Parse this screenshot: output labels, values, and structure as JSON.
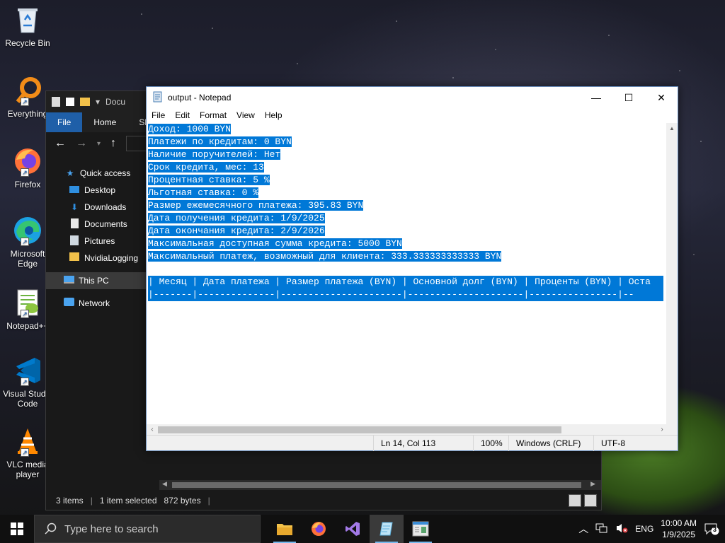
{
  "desktop": {
    "icons": [
      {
        "label": "Recycle Bin",
        "icon": "recycle-bin-icon"
      },
      {
        "label": "Everything",
        "icon": "everything-search-icon"
      },
      {
        "label": "Firefox",
        "icon": "firefox-icon"
      },
      {
        "label": "Microsoft Edge",
        "icon": "edge-icon"
      },
      {
        "label": "Notepad++",
        "icon": "notepadpp-icon"
      },
      {
        "label": "Visual Studio Code",
        "icon": "vscode-icon"
      },
      {
        "label": "VLC media player",
        "icon": "vlc-icon"
      }
    ]
  },
  "explorer": {
    "title_partial": "Docu",
    "ribbon_tabs": [
      "File",
      "Home",
      "Sh"
    ],
    "sidebar": [
      {
        "label": "Quick access",
        "icon": "star-icon"
      },
      {
        "label": "Desktop",
        "icon": "desktop-folder-icon"
      },
      {
        "label": "Downloads",
        "icon": "downloads-icon"
      },
      {
        "label": "Documents",
        "icon": "documents-icon"
      },
      {
        "label": "Pictures",
        "icon": "pictures-icon"
      },
      {
        "label": "NvidiaLogging",
        "icon": "folder-icon"
      },
      {
        "label": "This PC",
        "icon": "pc-icon"
      },
      {
        "label": "Network",
        "icon": "network-icon"
      }
    ],
    "status": {
      "items": "3 items",
      "selected": "1 item selected",
      "size": "872 bytes"
    }
  },
  "notepad": {
    "title": "output - Notepad",
    "menu": [
      "File",
      "Edit",
      "Format",
      "View",
      "Help"
    ],
    "lines": [
      "Доход: 1000 BYN",
      "Платежи по кредитам: 0 BYN",
      "Наличие поручителей: Нет",
      "Срок кредита, мес: 13",
      "Процентная ставка: 5 %",
      "Льготная ставка: 0 %",
      "Размер ежемесячного платежа: 395.83 BYN",
      "Дата получения кредита: 1/9/2025",
      "Дата окончания кредита: 2/9/2026",
      "Максимальная доступная сумма кредита: 5000 BYN",
      "Максимальный платеж, возможный для клиента: 333.333333333333 BYN",
      "",
      "| Месяц | Дата платежа | Размер платежа (BYN) | Основной долг (BYN) | Проценты (BYN) | Оста",
      "|-------|--------------|----------------------|---------------------|----------------|--"
    ],
    "status": {
      "position": "Ln 14, Col 113",
      "zoom": "100%",
      "line_ending": "Windows (CRLF)",
      "encoding": "UTF-8"
    }
  },
  "taskbar": {
    "search_placeholder": "Type here to search",
    "apps": [
      {
        "name": "file-explorer",
        "icon": "folder-icon"
      },
      {
        "name": "firefox",
        "icon": "firefox-icon"
      },
      {
        "name": "visual-studio",
        "icon": "visual-studio-icon"
      },
      {
        "name": "notepad",
        "icon": "notepad-icon"
      },
      {
        "name": "app",
        "icon": "window-app-icon"
      }
    ],
    "language": "ENG",
    "time": "10:00 AM",
    "date": "1/9/2025",
    "notifications": "3"
  }
}
